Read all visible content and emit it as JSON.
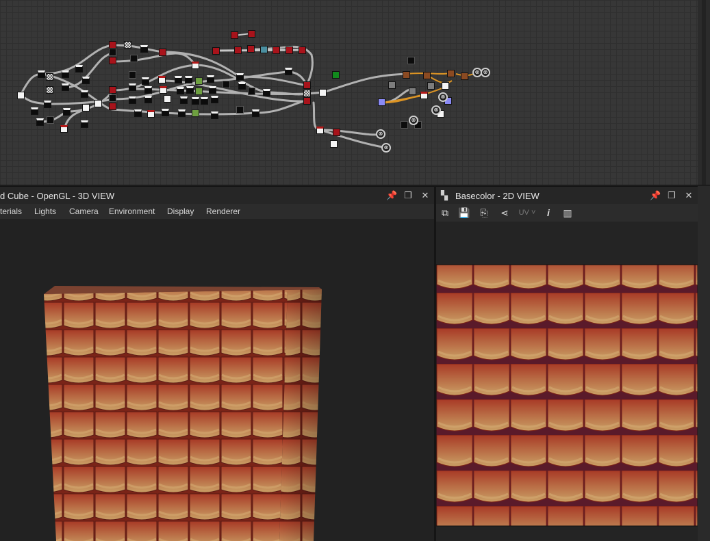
{
  "graph": {
    "output_icon_glyph": "⊗"
  },
  "view3d": {
    "title": "d Cube - OpenGL - 3D VIEW",
    "menu": [
      "terials",
      "Lights",
      "Camera",
      "Environment",
      "Display",
      "Renderer"
    ]
  },
  "view2d": {
    "title": "Basecolor - 2D VIEW",
    "uv_label": "UV",
    "toolbar_icons": [
      "layout-icon",
      "save-icon",
      "copy-icon",
      "share-icon",
      "uv-dropdown",
      "info-icon",
      "histogram-icon"
    ]
  },
  "colors": {
    "tile_light": "#c98a5e",
    "tile_dark": "#8e2b1f",
    "background": "#1c1c1c",
    "graph_bg": "#373737"
  }
}
